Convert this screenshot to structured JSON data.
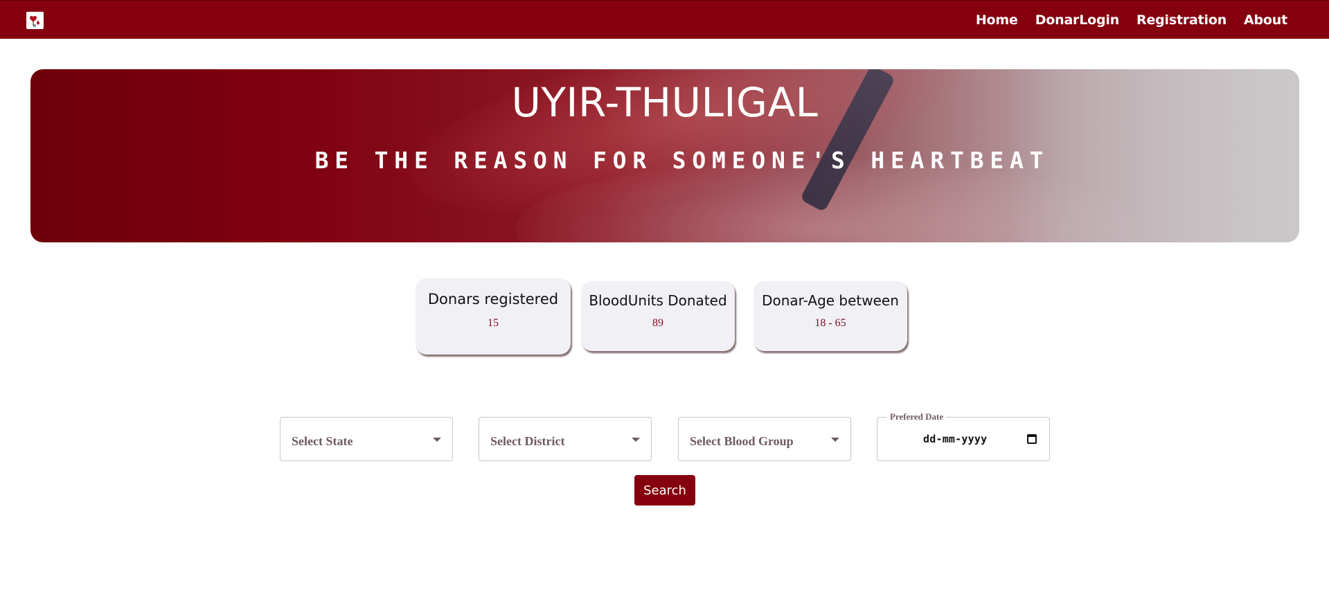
{
  "navbar": {
    "logo_icon": "blood-drop-heart-icon",
    "links": [
      {
        "label": "Home"
      },
      {
        "label": "DonarLogin"
      },
      {
        "label": "Registration"
      },
      {
        "label": "About"
      }
    ]
  },
  "hero": {
    "title": "UYIR-THULIGAL",
    "subtitle": "BE THE REASON FOR SOMEONE'S HEARTBEAT"
  },
  "stats": [
    {
      "label": "Donars registered",
      "value": "15"
    },
    {
      "label": "BloodUnits Donated",
      "value": "89"
    },
    {
      "label": "Donar-Age between",
      "value": "18 - 65"
    }
  ],
  "search": {
    "state_placeholder": "Select State",
    "district_placeholder": "Select District",
    "blood_group_placeholder": "Select Blood Group",
    "date_label": "Prefered Date",
    "date_value": "dd-mm-yyyy",
    "button_label": "Search"
  },
  "colors": {
    "brand": "#84000f",
    "card_bg": "#f1f0f5",
    "stat_value": "#7a1020"
  }
}
